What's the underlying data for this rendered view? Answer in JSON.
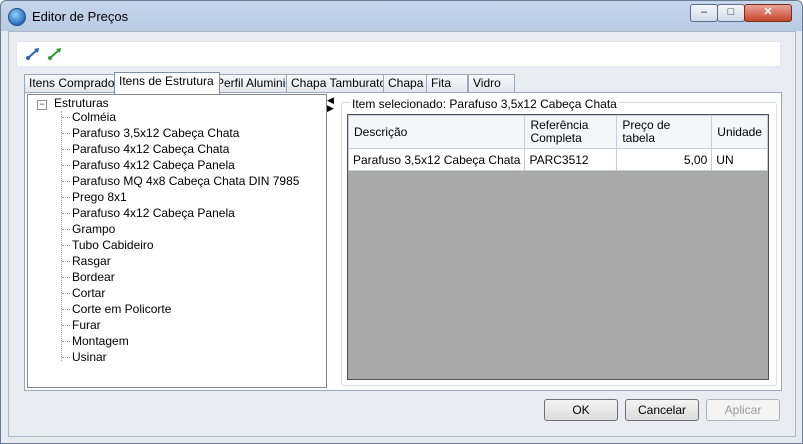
{
  "window": {
    "title": "Editor de Preços",
    "minimize_glyph": "–",
    "maximize_glyph": "□",
    "close_glyph": "✕"
  },
  "toolbar": {
    "icons": [
      "expand-icon",
      "collapse-icon"
    ]
  },
  "tabs": [
    {
      "label": "Itens Comprados",
      "active": false
    },
    {
      "label": "Itens de Estrutura",
      "active": true
    },
    {
      "label": "Perfil Aluminio",
      "active": false
    },
    {
      "label": "Chapa Tamburato",
      "active": false
    },
    {
      "label": "Chapa",
      "active": false
    },
    {
      "label": "Fita",
      "active": false
    },
    {
      "label": "Vidro",
      "active": false
    }
  ],
  "tree": {
    "root": "Estruturas",
    "toggle": "−",
    "items": [
      "Colméia",
      "Parafuso 3,5x12 Cabeça Chata",
      "Parafuso 4x12 Cabeça Chata",
      "Parafuso 4x12 Cabeça Panela",
      "Parafuso MQ 4x8 Cabeça Chata DIN 7985",
      "Prego 8x1",
      "Parafuso 4x12 Cabeça Panela",
      "Grampo",
      "Tubo Cabideiro",
      "Rasgar",
      "Bordear",
      "Cortar",
      "Corte em Policorte",
      "Furar",
      "Montagem",
      "Usinar"
    ]
  },
  "splitter": {
    "left_arrow": "◀",
    "right_arrow": "▶"
  },
  "selection": {
    "label": "Item selecionado: Parafuso 3,5x12 Cabeça Chata"
  },
  "grid": {
    "columns": [
      "Descrição",
      "Referência Completa",
      "Preço de tabela",
      "Unidade"
    ],
    "rows": [
      [
        "Parafuso 3,5x12 Cabeça Chata",
        "PARC3512",
        "5,00",
        "UN"
      ]
    ]
  },
  "buttons": {
    "ok": "OK",
    "cancel": "Cancelar",
    "apply": "Aplicar"
  },
  "colors": {
    "title_gradient": "#c5d5ea",
    "close_button": "#c8452d",
    "grid_background": "#a9a9a9"
  }
}
